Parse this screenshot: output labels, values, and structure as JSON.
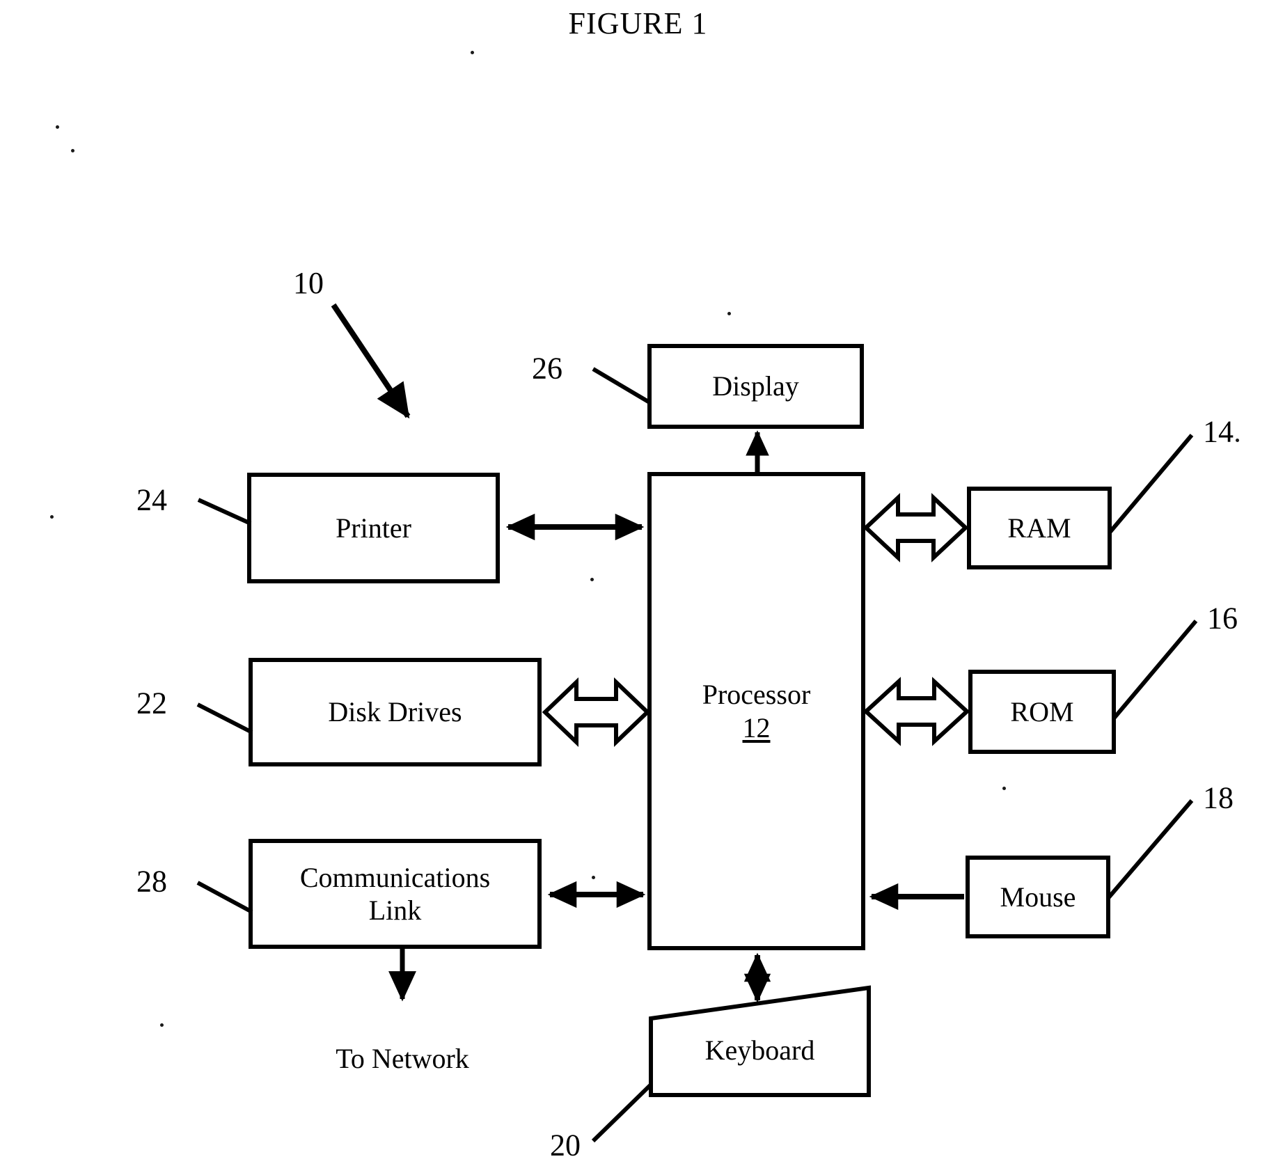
{
  "figure": {
    "title": "FIGURE 1",
    "domain": "patent-block-diagram"
  },
  "blocks": {
    "display": {
      "label": "Display",
      "ref": "26"
    },
    "printer": {
      "label": "Printer",
      "ref": "24"
    },
    "disk_drives": {
      "label": "Disk Drives",
      "ref": "22"
    },
    "communications_link": {
      "label_line1": "Communications",
      "label_line2": "Link",
      "ref": "28"
    },
    "processor": {
      "label": "Processor",
      "ref": "12"
    },
    "ram": {
      "label": "RAM",
      "ref": "14"
    },
    "rom": {
      "label": "ROM",
      "ref": "16"
    },
    "mouse": {
      "label": "Mouse",
      "ref": "18"
    },
    "keyboard": {
      "label": "Keyboard",
      "ref": "20"
    }
  },
  "annotations": {
    "system_ref": "10",
    "to_network": "To Network"
  },
  "colors": {
    "stroke": "#000000",
    "background": "#ffffff",
    "text": "#000000"
  },
  "connections": [
    {
      "from": "processor",
      "to": "display",
      "style": "solid-single-arrow",
      "direction": "up"
    },
    {
      "from": "printer",
      "to": "processor",
      "style": "solid-double-arrow",
      "direction": "horizontal"
    },
    {
      "from": "disk_drives",
      "to": "processor",
      "style": "hollow-double-arrow",
      "direction": "horizontal"
    },
    {
      "from": "communications_link",
      "to": "processor",
      "style": "solid-double-arrow",
      "direction": "horizontal"
    },
    {
      "from": "processor",
      "to": "ram",
      "style": "hollow-double-arrow",
      "direction": "horizontal"
    },
    {
      "from": "processor",
      "to": "rom",
      "style": "hollow-double-arrow",
      "direction": "horizontal"
    },
    {
      "from": "mouse",
      "to": "processor",
      "style": "solid-single-arrow",
      "direction": "left"
    },
    {
      "from": "keyboard",
      "to": "processor",
      "style": "solid-double-arrow",
      "direction": "vertical"
    },
    {
      "from": "communications_link",
      "to": "to_network",
      "style": "solid-single-arrow",
      "direction": "down"
    }
  ]
}
